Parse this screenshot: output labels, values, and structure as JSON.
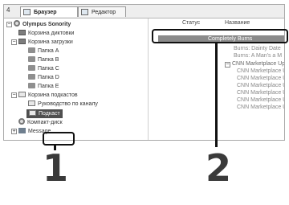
{
  "window": {
    "tab_number": "4",
    "tabs": [
      {
        "label": "Браузер"
      },
      {
        "label": "Редактор"
      }
    ]
  },
  "tree": {
    "items": [
      {
        "label": "Olympus Sonority",
        "icon": "disc-icon"
      },
      {
        "label": "Корзина диктовки",
        "icon": "trash-icon"
      },
      {
        "label": "Корзина загрузки",
        "icon": "download-tray-icon"
      },
      {
        "label": "Папка A",
        "icon": "folder-icon"
      },
      {
        "label": "Папка B",
        "icon": "folder-icon"
      },
      {
        "label": "Папка C",
        "icon": "folder-icon"
      },
      {
        "label": "Папка D",
        "icon": "folder-icon"
      },
      {
        "label": "Папка E",
        "icon": "folder-icon"
      },
      {
        "label": "Корзина подкастов",
        "icon": "podcast-tray-icon"
      },
      {
        "label": "Руководство по каналу",
        "icon": "guide-icon"
      },
      {
        "label": "Подкаст",
        "icon": "podcast-icon"
      },
      {
        "label": "Компакт-диск",
        "icon": "cd-icon"
      },
      {
        "label": "Message",
        "icon": "message-icon"
      }
    ]
  },
  "list": {
    "columns": [
      "",
      "Статус",
      "Название"
    ],
    "selected_label": "Completely Burns",
    "items": [
      "Burns: Dainty Date",
      "Burns: A Man's a M",
      "CNN Marketplace Upd",
      "CNN Marketplace Up",
      "CNN Marketplace Up",
      "CNN Marketplace Up",
      "CNN Marketplace Up",
      "CNN Marketplace Up",
      "CNN Marketplace Up"
    ]
  },
  "callouts": {
    "one": "1",
    "two": "2"
  }
}
